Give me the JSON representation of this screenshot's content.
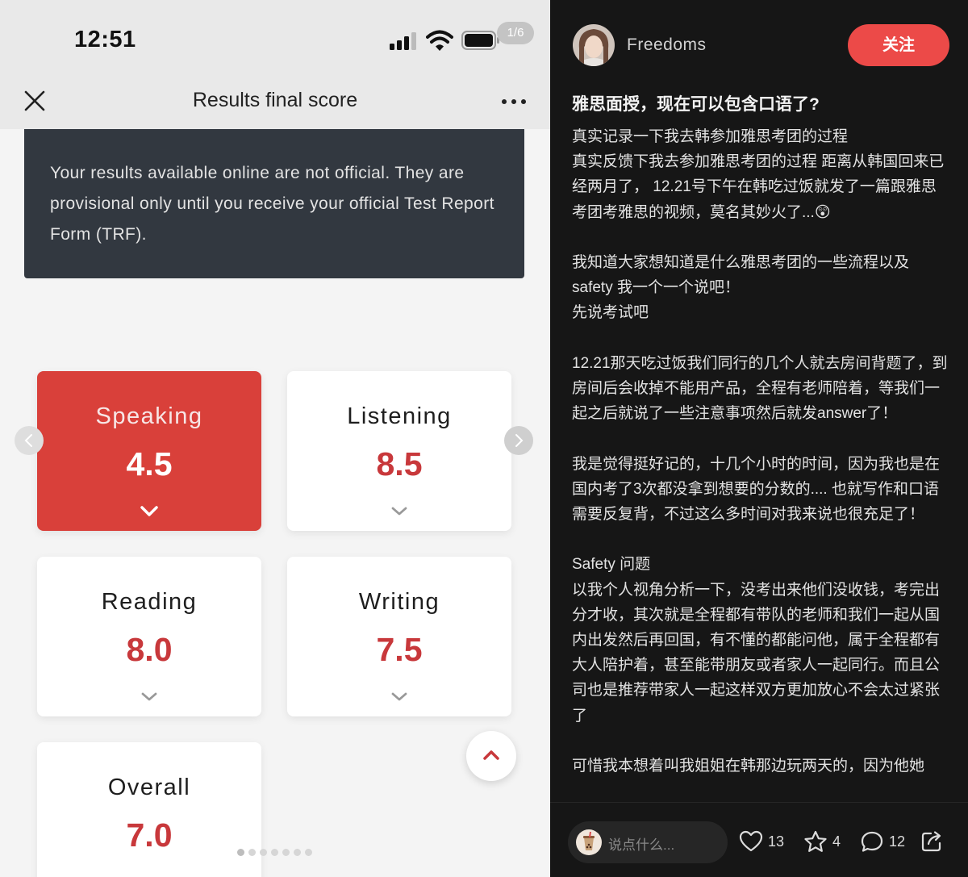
{
  "viewer": {
    "status_time": "12:51",
    "page_indicator": "1/6",
    "nav_title": "Results final score",
    "notice_text": "Your results available online are not official. They are provisional only until you receive your official Test Report Form (TRF).",
    "scores": {
      "speaking": {
        "label": "Speaking",
        "value": "4.5"
      },
      "listening": {
        "label": "Listening",
        "value": "8.5"
      },
      "reading": {
        "label": "Reading",
        "value": "8.0"
      },
      "writing": {
        "label": "Writing",
        "value": "7.5"
      },
      "overall": {
        "label": "Overall",
        "value": "7.0"
      }
    },
    "colors": {
      "active_card": "#d9403a",
      "score_red": "#c8383b",
      "notice_bg": "#323840"
    }
  },
  "post": {
    "author": "Freedoms",
    "follow_label": "关注",
    "title": "雅思面授，现在可以包含口语了?",
    "body": [
      "真实记录一下我去韩参加雅思考团的过程",
      "真实反馈下我去参加雅思考团的过程 距离从韩国回来已经两月了， 12.21号下午在韩吃过饭就发了一篇跟雅思考团考雅思的视频，莫名其妙火了...😲",
      "",
      "我知道大家想知道是什么雅思考团的一些流程以及safety 我一个一个说吧！",
      "先说考试吧",
      "",
      "12.21那天吃过饭我们同行的几个人就去房间背题了，到房间后会收掉不能用产品，全程有老师陪着，等我们一起之后就说了一些注意事项然后就发answer了！",
      "",
      "我是觉得挺好记的，十几个小时的时间，因为我也是在国内考了3次都没拿到想要的分数的.... 也就写作和口语需要反复背，不过这么多时间对我来说也很充足了！",
      "",
      "Safety 问题",
      "以我个人视角分析一下，没考出来他们没收钱，考完出分才收，其次就是全程都有带队的老师和我们一起从国内出发然后再回国，有不懂的都能问他，属于全程都有大人陪护着，甚至能带朋友或者家人一起同行。而且公司也是推荐带家人一起这样双方更加放心不会太过紧张了",
      "",
      "可惜我本想着叫我姐姐在韩那边玩两天的，因为他她"
    ],
    "comment_placeholder": "说点什么...",
    "likes": "13",
    "collects": "4",
    "comments": "12",
    "colors": {
      "follow_button": "#ec4a48",
      "background": "#161616"
    }
  }
}
